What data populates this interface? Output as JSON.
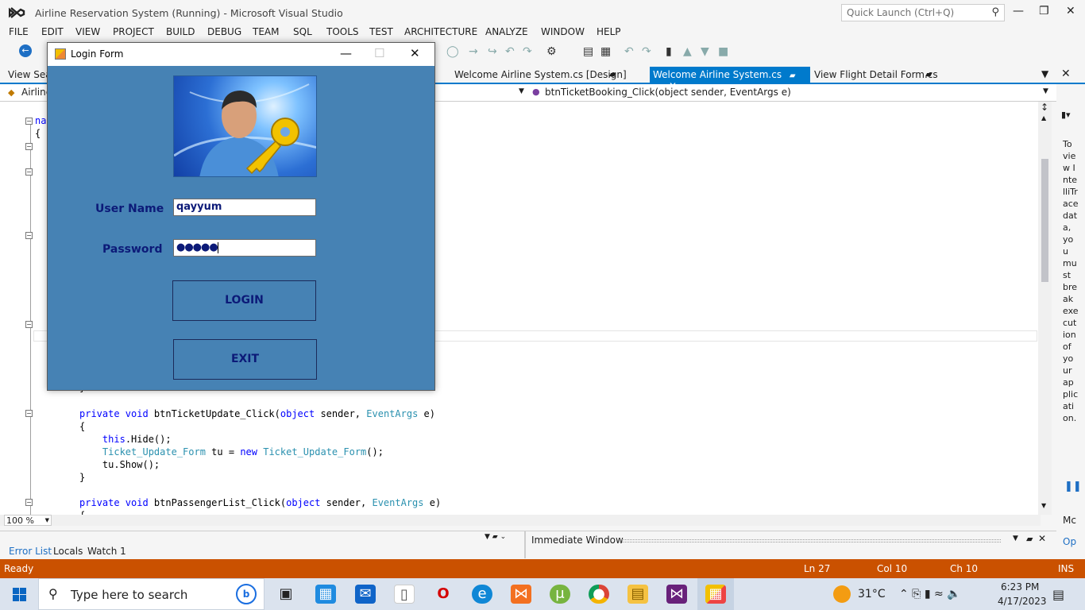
{
  "ide": {
    "title": "Airline Reservation System (Running) - Microsoft Visual Studio",
    "quick_launch": "Quick Launch (Ctrl+Q)",
    "menu": [
      "FILE",
      "EDIT",
      "VIEW",
      "PROJECT",
      "BUILD",
      "DEBUG",
      "TEAM",
      "SQL",
      "TOOLS",
      "TEST",
      "ARCHITECTURE",
      "ANALYZE",
      "WINDOW",
      "HELP"
    ],
    "tabs": {
      "left": "View Seat",
      "design": "Welcome Airline System.cs [Design]",
      "active": "Welcome Airline System.cs",
      "flight": "View Flight Detail Form.cs"
    },
    "nav_left": "Airline",
    "nav_method": "btnTicketBooking_Click(object sender, EventArgs e)",
    "code_top": "na",
    "code_brace": "{",
    "code_lines": [
      {
        "a": "private void ",
        "b": "btnTicketUpdate_Click(",
        "c": "object",
        " d": "",
        "e": " sender, ",
        "f": "EventArgs",
        "g": " e)"
      },
      {
        "a": "{"
      },
      {
        "a": "this.Hide();"
      },
      {
        "a": "Ticket_Update_Form",
        " b": ""
      },
      {
        "a": "tu.Show();"
      },
      {
        "a": "}"
      },
      {
        "a": "private void btnPassengerList_Click(object sender, EventArgs e)"
      }
    ],
    "zoom": "100 %",
    "bottom_tabs": [
      "Error List",
      "Locals",
      "Watch 1"
    ],
    "error_list_cut": "Error List",
    "immediate": "Immediate Window",
    "intellitrace_text": "To view IntelliTrace data, you must break execution of your application.",
    "right_extra": [
      "Mc",
      "Op"
    ],
    "status": {
      "ready": "Ready",
      "ln": "Ln 27",
      "col": "Col 10",
      "ch": "Ch 10",
      "ins": "INS"
    }
  },
  "login": {
    "title": "Login Form",
    "username_label": "User Name",
    "username_value": "qayyum",
    "password_label": "Password",
    "password_value": "●●●●●",
    "login_button": "LOGIN",
    "exit_button": "EXIT"
  },
  "taskbar": {
    "search": "Type here to search",
    "weather": "31°C",
    "time": "6:23 PM",
    "date": "4/17/2023"
  }
}
